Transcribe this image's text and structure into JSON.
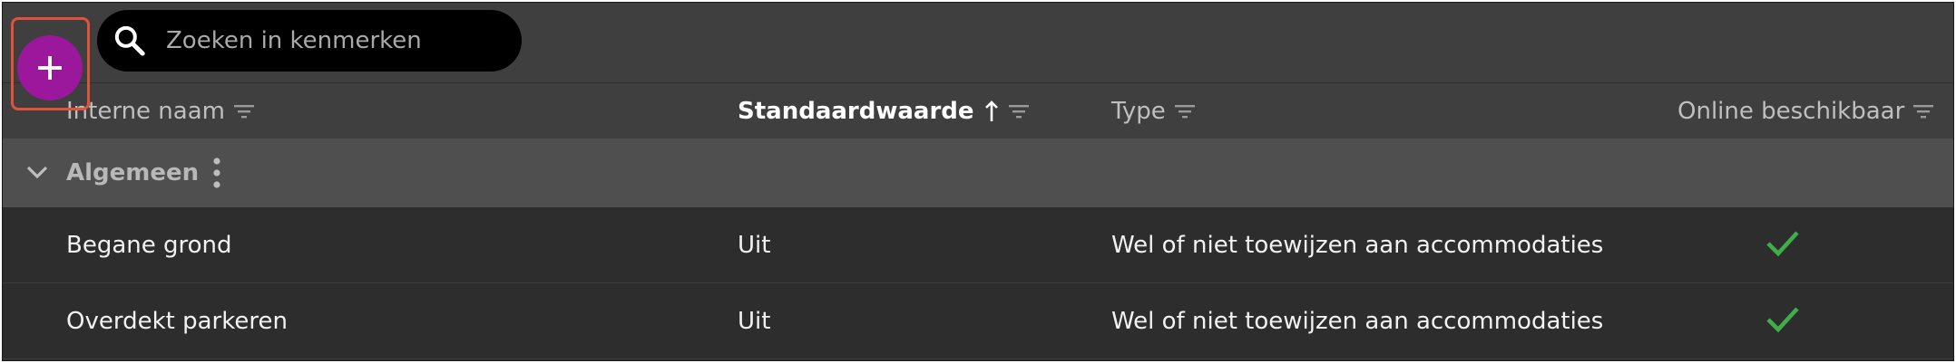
{
  "search": {
    "placeholder": "Zoeken in kenmerken",
    "value": ""
  },
  "table": {
    "columns": [
      {
        "label": "Interne naam",
        "sortable": true,
        "filter": true
      },
      {
        "label": "Standaardwaarde",
        "sorted": "ascending",
        "filter": true
      },
      {
        "label": "Type",
        "filter": true
      },
      {
        "label": "Online beschikbaar",
        "filter": true
      }
    ],
    "group": {
      "label": "Algemeen",
      "expanded": true
    },
    "rows": [
      {
        "name": "Begane grond",
        "default": "Uit",
        "type": "Wel of niet toewijzen aan accommodaties",
        "online": true
      },
      {
        "name": "Overdekt parkeren",
        "default": "Uit",
        "type": "Wel of niet toewijzen aan accommodaties",
        "online": true
      }
    ]
  },
  "icons": {
    "add": "plus-icon",
    "search": "search-icon",
    "filter": "filter-icon",
    "sort": "arrow-up-icon",
    "group_toggle": "chevron-down-icon",
    "group_menu": "more-vertical-icon",
    "available": "check-icon"
  },
  "colors": {
    "fab": "#9b179c",
    "highlight": "#e0533a",
    "check": "#3fae49",
    "background": "#2d2d2d",
    "header": "#3f3f3f",
    "group": "#4f4f4f"
  }
}
